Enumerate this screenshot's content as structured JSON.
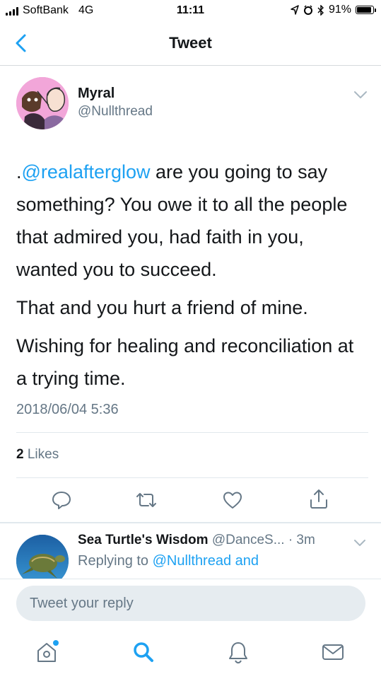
{
  "status_bar": {
    "carrier": "SoftBank",
    "network": "4G",
    "time": "11:11",
    "battery": "91%",
    "battery_level": 0.91
  },
  "nav": {
    "title": "Tweet",
    "back_icon": "chevron-left-icon"
  },
  "tweet": {
    "author_name": "Myral",
    "author_handle": "@Nullthread",
    "paragraphs": [
      {
        "prefix": ".",
        "mention": "@realafterglow",
        "text": " are you going to say something? You owe it to all the people that admired you, had faith in you, wanted you to succeed."
      },
      {
        "text": "That and you hurt a friend of mine."
      },
      {
        "text": "Wishing for healing and reconciliation at a trying time."
      }
    ],
    "timestamp": "2018/06/04 5:36",
    "likes_count": "2",
    "likes_label": " Likes",
    "actions": [
      "reply-icon",
      "retweet-icon",
      "like-icon",
      "share-icon"
    ]
  },
  "reply": {
    "name": "Sea Turtle's Wisdom",
    "handle": "@DanceS...",
    "time": "· 3m",
    "replying_prefix": "Replying to ",
    "replying_to": "@Nullthread and"
  },
  "compose": {
    "placeholder": "Tweet your reply"
  },
  "tabbar": {
    "items": [
      "home-icon",
      "search-icon",
      "notifications-icon",
      "messages-icon"
    ],
    "active": "search-icon",
    "accent": "#1da1f2"
  },
  "colors": {
    "accent": "#1da1f2",
    "secondary_text": "#657786",
    "divider": "#e1e8ed"
  }
}
